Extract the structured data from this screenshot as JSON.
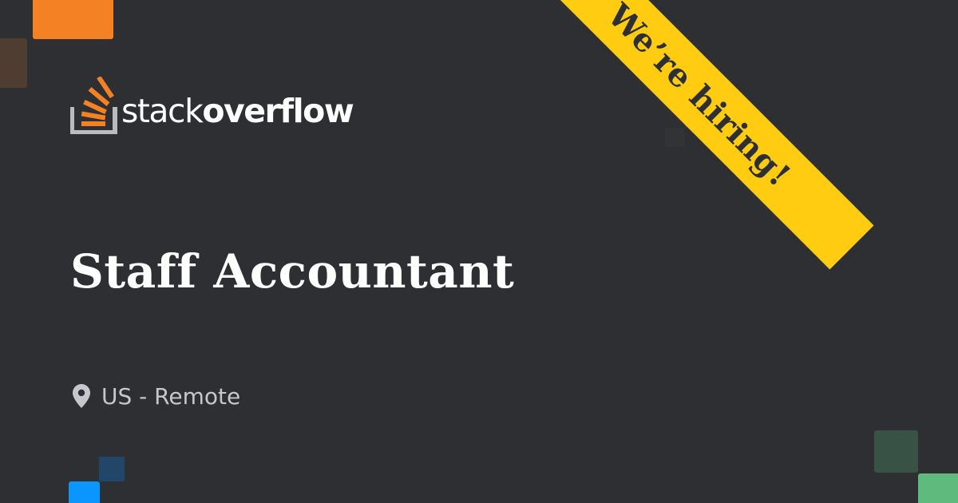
{
  "brand": {
    "logo_text_light": "stack",
    "logo_text_bold": "overflow",
    "logo_icon": "stack-overflow-logo-icon",
    "accent_color": "#f48225"
  },
  "job": {
    "title": "Staff Accountant",
    "location": "US - Remote",
    "location_icon": "map-pin-icon"
  },
  "ribbon": {
    "text": "We’re hiring!",
    "color": "#ffcc11"
  },
  "colors": {
    "background": "#2d2f33",
    "title_text": "#ffffff",
    "location_text": "#c4c8cc",
    "decor_orange": "#f48225",
    "decor_blue": "#0a95ff",
    "decor_green": "#5eba7d"
  }
}
